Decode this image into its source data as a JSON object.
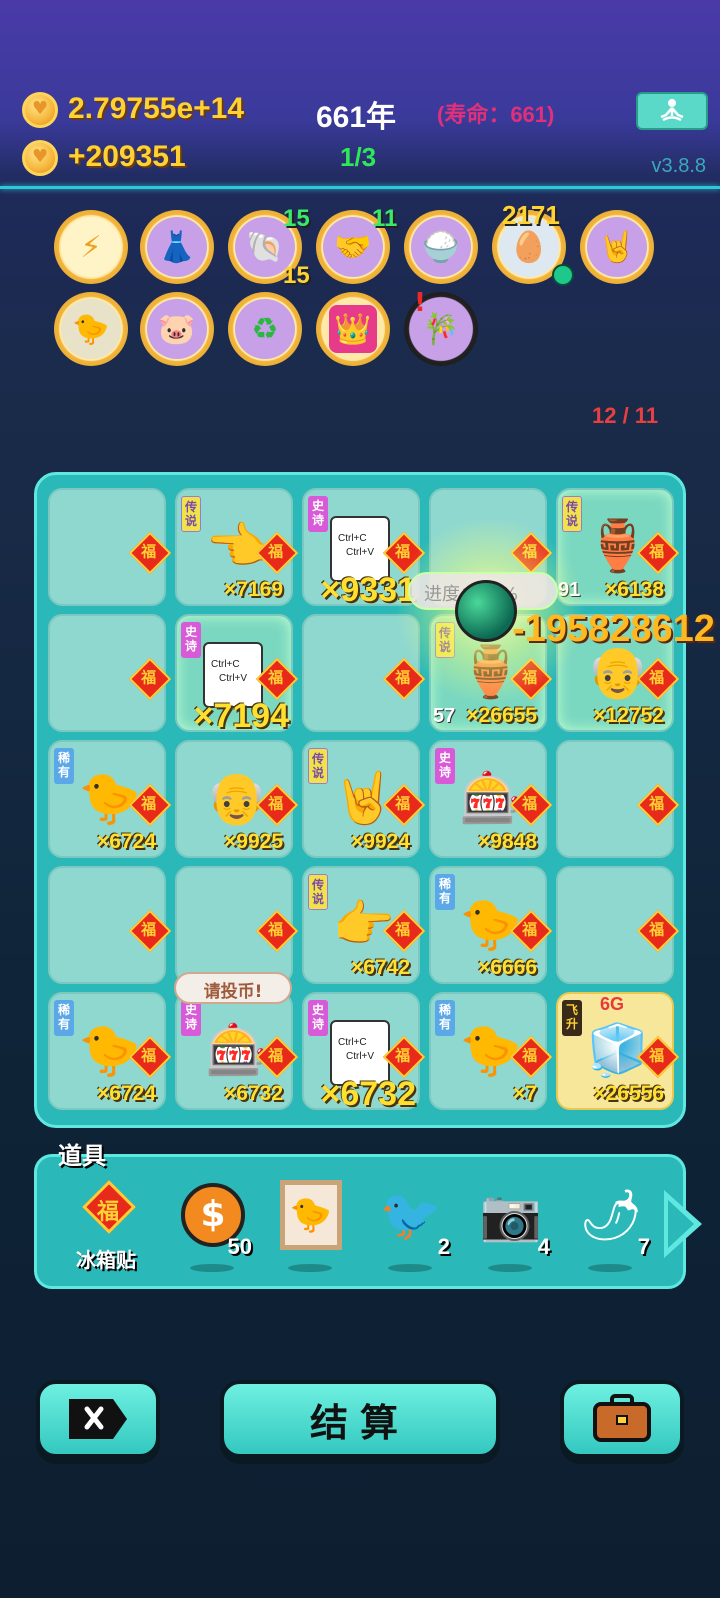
{
  "header": {
    "gold": "2.79755e+14",
    "income": "+209351",
    "year": "661年",
    "lifespan": "(寿命：661)",
    "wave": "1/3",
    "version": "v3.8.8"
  },
  "skills": {
    "shell_count_top": "15",
    "shell_count_bottom": "15",
    "handshake_count": "11",
    "tray_count": "2171"
  },
  "counter": "12 / 11",
  "fu_char": "福",
  "tags": {
    "legend": "传说",
    "epic": "史诗",
    "rare": "稀有",
    "fly": "飞升"
  },
  "grid": {
    "r0c1_qty": "×7169",
    "r0c2_qty": "×9331",
    "r0c4_left": "91",
    "r0c4_qty": "×6138",
    "r1c1_qty": "×7194",
    "r1c3_left": "57",
    "r1c3_qty": "×26655",
    "r1c4_qty": "×12752",
    "r2c0_qty": "×6724",
    "r2c1_qty": "×9925",
    "r2c2_qty": "×9924",
    "r2c3_qty": "×9848",
    "r3c2_qty": "×6742",
    "r3c3_qty": "×6666",
    "r4c0_qty": "×6724",
    "r4c1_qty": "×6732",
    "r4c2_qty": "×6732",
    "r4c3_qty": "×7",
    "r4c4_qty": "×26556",
    "fridge_label": "6G",
    "ctrl_c": "Ctrl+C",
    "ctrl_v": "Ctrl+V",
    "progress_text": "进度：35%",
    "damage_text": "-195828612",
    "speech": "请投币!"
  },
  "items": {
    "title": "道具",
    "fridge_sticker_label": "冰箱贴",
    "coin_count": "50",
    "bird_count": "2",
    "camera_count": "4",
    "pepper_count": "7"
  },
  "buttons": {
    "settle_label": "结算"
  }
}
